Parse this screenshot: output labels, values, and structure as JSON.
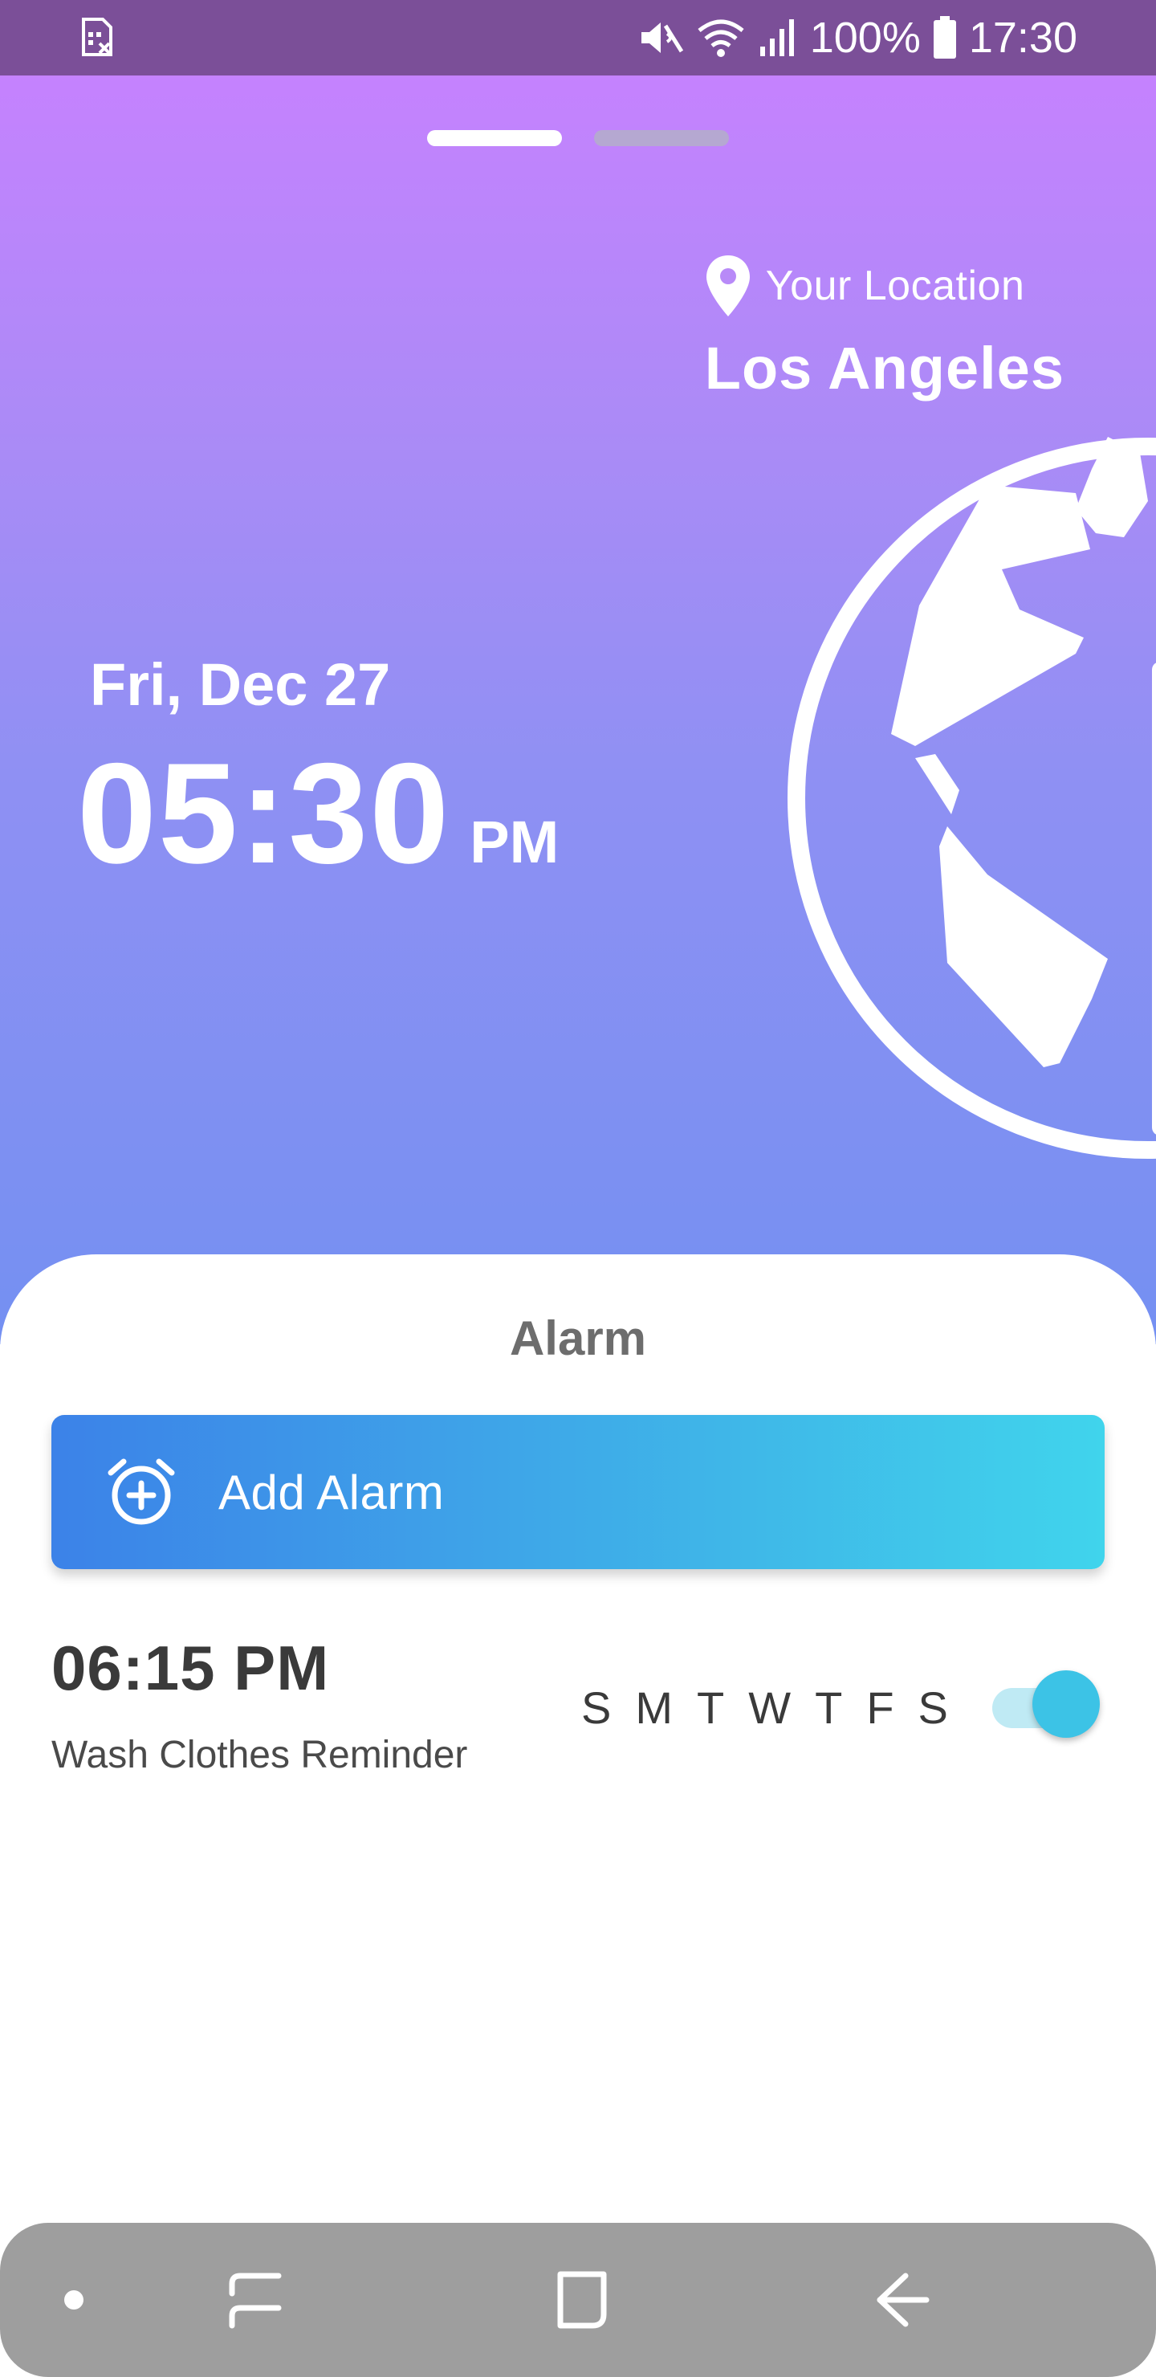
{
  "status_bar": {
    "battery": "100%",
    "time": "17:30",
    "icons": [
      "sim-off-icon",
      "mute-icon",
      "wifi-icon",
      "signal-icon",
      "battery-icon"
    ]
  },
  "header": {
    "location_label": "Your Location",
    "city": "Los Angeles",
    "date": "Fri, Dec 27",
    "time": "05:30",
    "period": "PM"
  },
  "colors": {
    "status_bar": "#7b4f98",
    "gradient_top": "#c582fe",
    "gradient_bottom": "#7490f2",
    "button_start": "#3c82e8",
    "button_end": "#40d4ec",
    "toggle_on": "#3cc3e6",
    "nav_bar": "#9e9e9e"
  },
  "alarm_section": {
    "title": "Alarm",
    "add_button_label": "Add Alarm",
    "alarms": [
      {
        "time": "06:15 PM",
        "label": "Wash Clothes Reminder",
        "days": [
          "S",
          "M",
          "T",
          "W",
          "T",
          "F",
          "S"
        ],
        "enabled": true
      }
    ]
  },
  "nav": {
    "buttons": [
      "dot-icon",
      "recents-icon",
      "home-icon",
      "back-icon"
    ]
  }
}
